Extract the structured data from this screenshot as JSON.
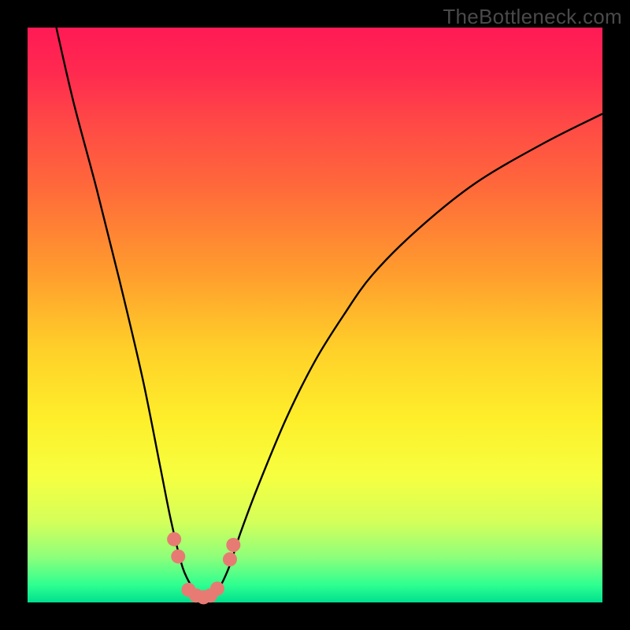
{
  "attribution": "TheBottleneck.com",
  "chart_data": {
    "type": "line",
    "title": "",
    "xlabel": "",
    "ylabel": "",
    "xlim": [
      0,
      100
    ],
    "ylim": [
      0,
      100
    ],
    "series": [
      {
        "name": "bottleneck-curve",
        "x": [
          5,
          8,
          12,
          16,
          20,
          23,
          25,
          27,
          29,
          30,
          31,
          33,
          35,
          37,
          40,
          45,
          50,
          55,
          60,
          68,
          78,
          90,
          100
        ],
        "y": [
          100,
          87,
          72,
          56,
          39,
          24,
          14,
          6,
          2,
          0.5,
          0.5,
          2,
          6,
          12,
          20,
          32,
          42,
          50,
          57,
          65,
          73,
          80,
          85
        ]
      }
    ],
    "markers": {
      "name": "salmon-dots",
      "color": "#e77b73",
      "points": [
        {
          "x": 25.5,
          "y": 11
        },
        {
          "x": 26.2,
          "y": 8
        },
        {
          "x": 28.0,
          "y": 2.2
        },
        {
          "x": 29.3,
          "y": 1.2
        },
        {
          "x": 30.6,
          "y": 0.9
        },
        {
          "x": 31.8,
          "y": 1.2
        },
        {
          "x": 33.0,
          "y": 2.4
        },
        {
          "x": 35.2,
          "y": 7.5
        },
        {
          "x": 35.8,
          "y": 10
        }
      ]
    },
    "background": {
      "type": "vertical-gradient",
      "stops": [
        {
          "pos": 0,
          "color": "#ff1a55"
        },
        {
          "pos": 28,
          "color": "#ff6a3a"
        },
        {
          "pos": 56,
          "color": "#ffd029"
        },
        {
          "pos": 78,
          "color": "#f6ff40"
        },
        {
          "pos": 100,
          "color": "#00e08e"
        }
      ]
    }
  }
}
